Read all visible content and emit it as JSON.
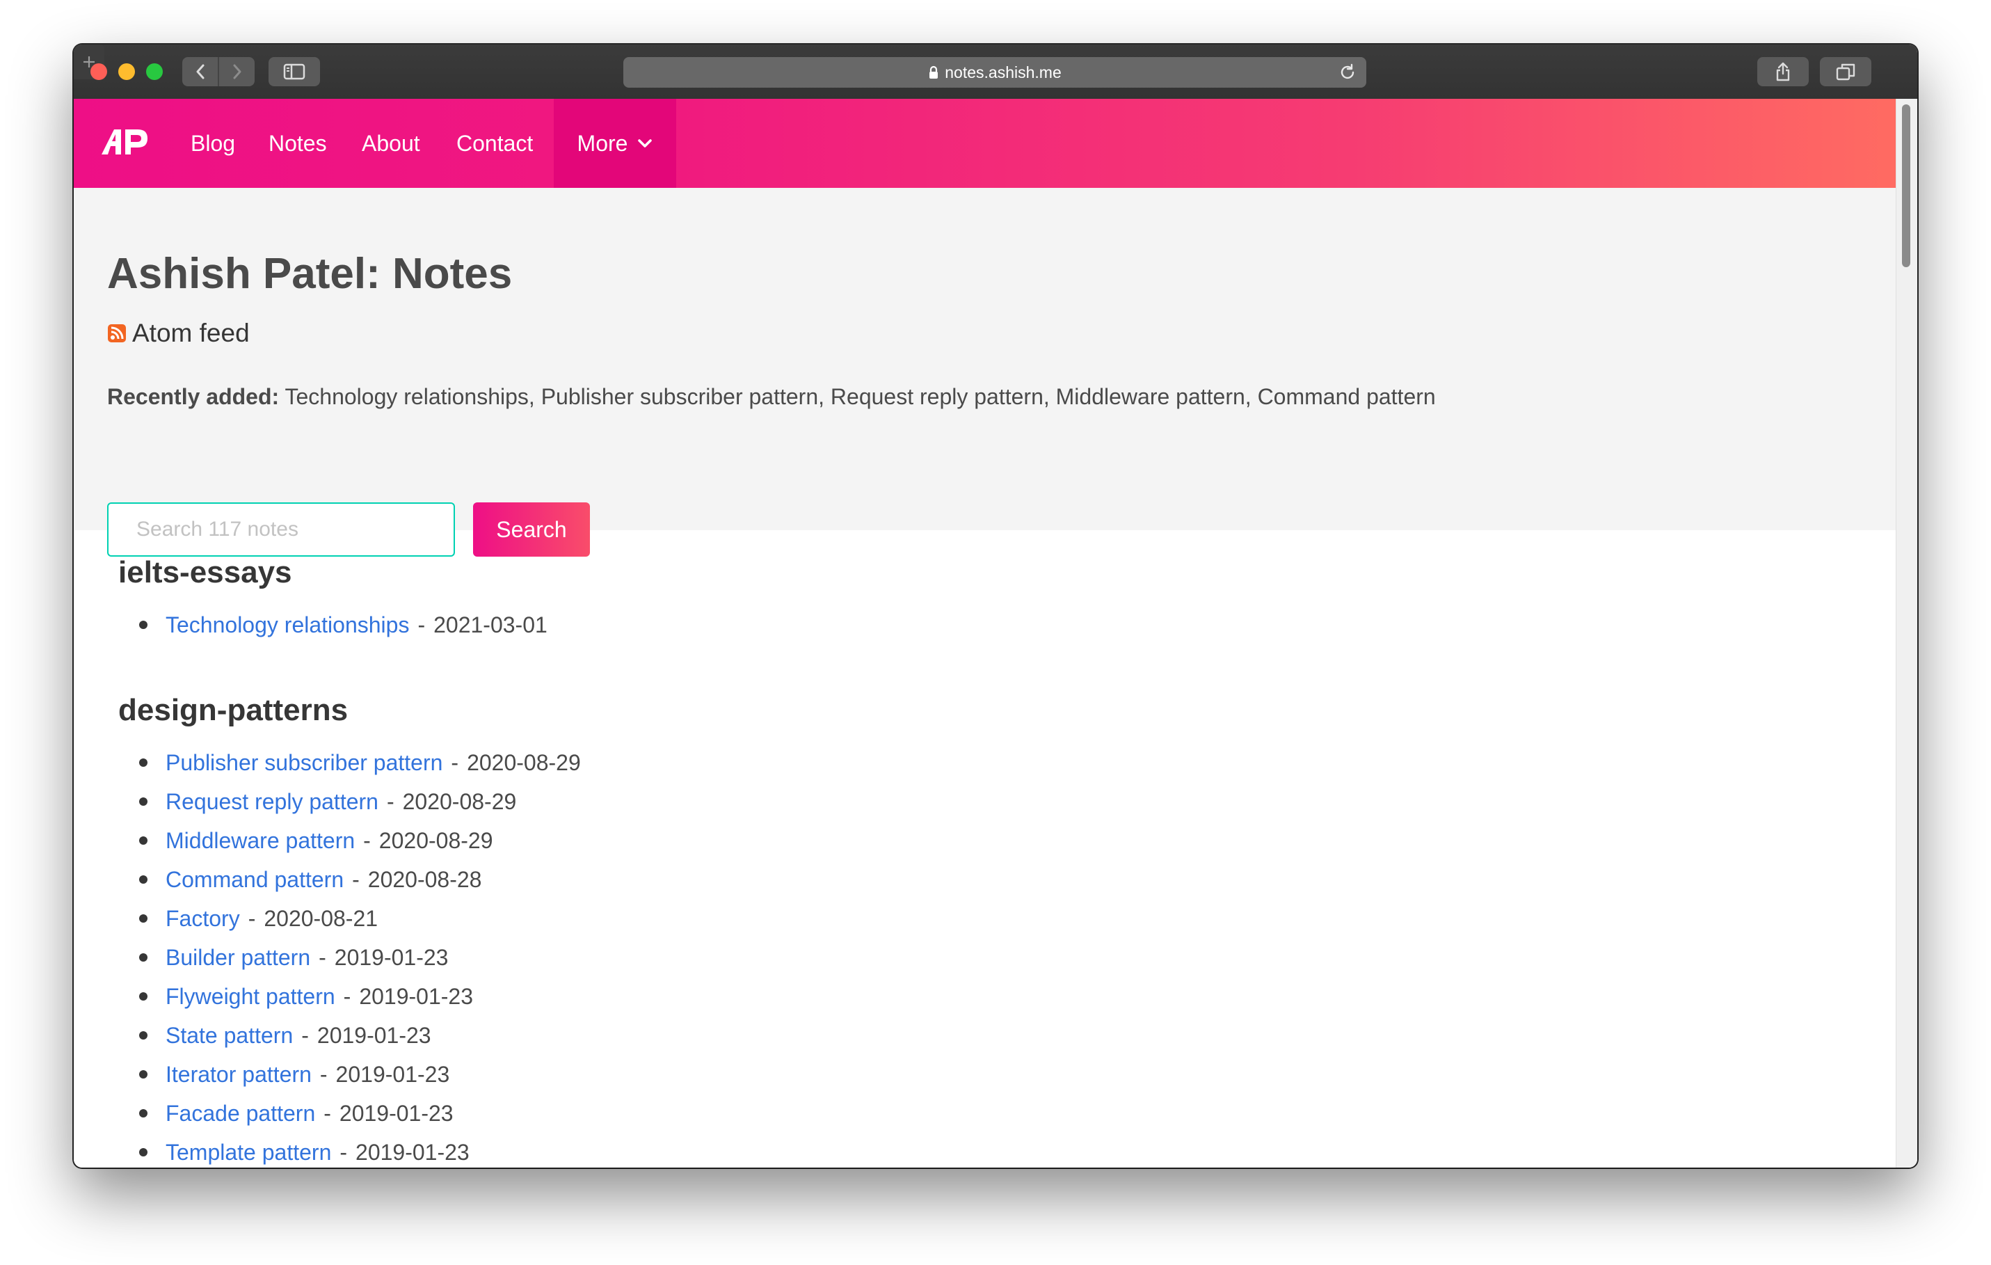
{
  "browser": {
    "url": "notes.ashish.me"
  },
  "nav": {
    "logo_text": "AP",
    "items": [
      "Blog",
      "Notes",
      "About",
      "Contact"
    ],
    "more_label": "More"
  },
  "hero": {
    "title": "Ashish Patel: Notes",
    "feed_label": "Atom feed",
    "recent_label": "Recently added:",
    "recent_items": "Technology relationships, Publisher subscriber pattern, Request reply pattern, Middleware pattern, Command pattern",
    "search_placeholder": "Search 117 notes",
    "search_button": "Search"
  },
  "sections": [
    {
      "heading": "ielts-essays",
      "notes": [
        {
          "title": "Technology relationships",
          "date": "2021-03-01"
        }
      ]
    },
    {
      "heading": "design-patterns",
      "notes": [
        {
          "title": "Publisher subscriber pattern",
          "date": "2020-08-29"
        },
        {
          "title": "Request reply pattern",
          "date": "2020-08-29"
        },
        {
          "title": "Middleware pattern",
          "date": "2020-08-29"
        },
        {
          "title": "Command pattern",
          "date": "2020-08-28"
        },
        {
          "title": "Factory",
          "date": "2020-08-21"
        },
        {
          "title": "Builder pattern",
          "date": "2019-01-23"
        },
        {
          "title": "Flyweight pattern",
          "date": "2019-01-23"
        },
        {
          "title": "State pattern",
          "date": "2019-01-23"
        },
        {
          "title": "Iterator pattern",
          "date": "2019-01-23"
        },
        {
          "title": "Facade pattern",
          "date": "2019-01-23"
        },
        {
          "title": "Template pattern",
          "date": "2019-01-23"
        }
      ]
    }
  ],
  "colors": {
    "brand_pink": "#ee0f86",
    "brand_coral": "#ff6b62",
    "link_blue": "#3273dc",
    "input_border": "#00d1b2"
  }
}
